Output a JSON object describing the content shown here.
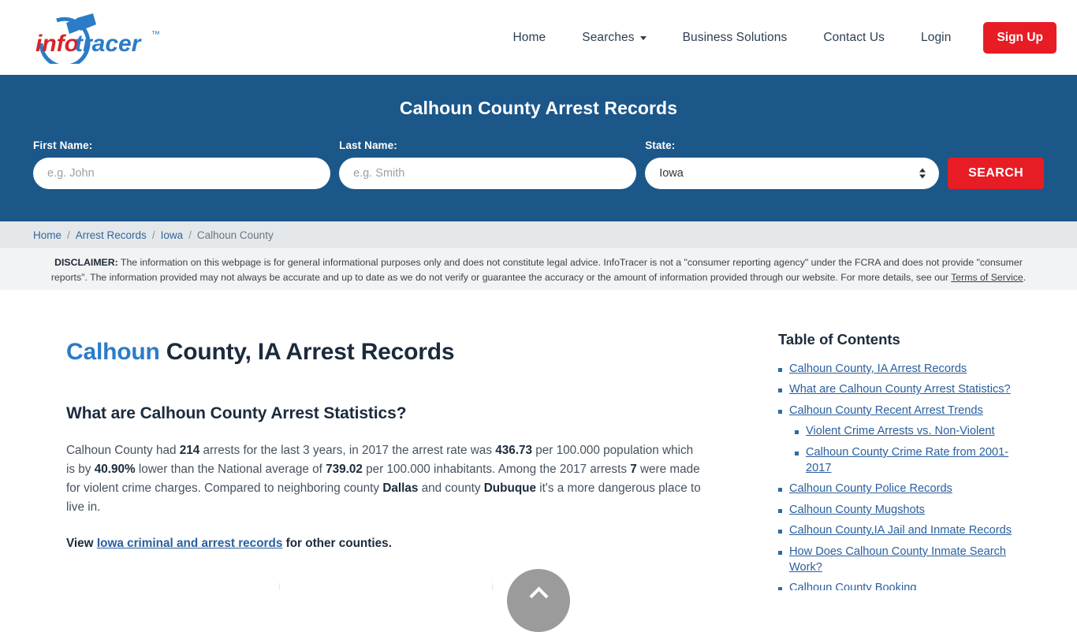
{
  "header": {
    "logo_text": "infotracer",
    "logo_tm": "™",
    "nav": [
      {
        "label": "Home",
        "icon": null
      },
      {
        "label": "Searches",
        "icon": "chevron-down-icon"
      },
      {
        "label": "Business Solutions",
        "icon": null
      },
      {
        "label": "Contact Us",
        "icon": null
      },
      {
        "label": "Login",
        "icon": null
      }
    ],
    "signup_label": "Sign Up",
    "signup_color": "#e81c24"
  },
  "banner": {
    "title": "Calhoun County Arrest Records",
    "bg_color": "#1b5789",
    "first_name_label": "First Name:",
    "first_name_placeholder": "e.g. John",
    "first_name_value": "",
    "last_name_label": "Last Name:",
    "last_name_placeholder": "e.g. Smith",
    "last_name_value": "",
    "state_label": "State:",
    "state_value": "Iowa",
    "state_options": [
      "Iowa"
    ],
    "search_label": "SEARCH"
  },
  "breadcrumb": {
    "items": [
      "Home",
      "Arrest Records",
      "Iowa",
      "Calhoun County"
    ],
    "separator": "/"
  },
  "disclaimer": {
    "label": "DISCLAIMER:",
    "text": " The information on this webpage is for general informational purposes only and does not constitute legal advice. InfoTracer is not a \"consumer reporting agency\" under the FCRA and does not provide \"consumer reports\". The information provided may not always be accurate and up to date as we do not verify or guarantee the accuracy or the amount of information provided through our website. For more details, see our ",
    "link_text": "Terms of Service",
    "tail": "."
  },
  "main": {
    "title_highlight": "Calhoun",
    "title_rest": " County, IA Arrest Records",
    "section_heading": "What are Calhoun County Arrest Statistics?",
    "paragraph": {
      "p1": "Calhoun County had ",
      "b1": "214",
      "p2": " arrests for the last 3 years, in 2017 the arrest rate was ",
      "b2": "436.73",
      "p3": " per 100.000 population which is by ",
      "b3": "40.90%",
      "p4": " lower than the National average of ",
      "b4": "739.02",
      "p5": " per 100.000 inhabitants. Among the 2017 arrests ",
      "b5": "7",
      "p6": " were made for violent crime charges. Compared to neighboring county ",
      "b6": "Dallas",
      "p7": " and county ",
      "b7": "Dubuque",
      "p8": " it's a more dangerous place to live in."
    },
    "view_prefix": "View ",
    "view_link": "Iowa criminal and arrest records",
    "view_suffix": " for other counties.",
    "icons": [
      "handcuffs-icon",
      "trend-arrow-icon",
      "pen-icon"
    ]
  },
  "toc": {
    "title": "Table of Contents",
    "items": [
      {
        "label": "Calhoun County, IA Arrest Records",
        "level": 1
      },
      {
        "label": "What are Calhoun County Arrest Statistics?",
        "level": 1
      },
      {
        "label": "Calhoun County Recent Arrest Trends",
        "level": 1
      },
      {
        "label": "Violent Crime Arrests vs. Non-Violent",
        "level": 2
      },
      {
        "label": "Calhoun County Crime Rate from 2001-2017",
        "level": 2
      },
      {
        "label": "Calhoun County Police Records",
        "level": 1
      },
      {
        "label": "Calhoun County Mugshots",
        "level": 1
      },
      {
        "label": "Calhoun County,IA Jail and Inmate Records",
        "level": 1
      },
      {
        "label": "How Does Calhoun County Inmate Search Work?",
        "level": 1
      },
      {
        "label": "Calhoun County Booking",
        "level": 1
      }
    ]
  },
  "scroll_top": {
    "icon": "chevron-up-icon"
  }
}
